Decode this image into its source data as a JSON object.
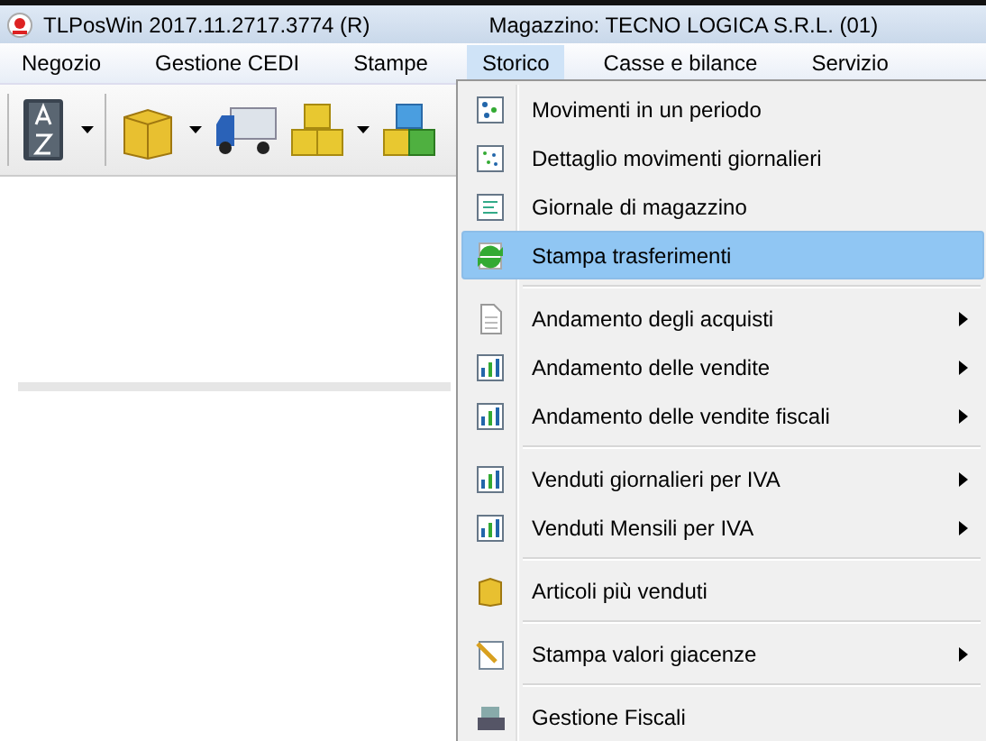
{
  "window": {
    "title": "TLPosWin 2017.11.2717.3774 (R)",
    "subtitle": "Magazzino: TECNO LOGICA S.R.L. (01)"
  },
  "menubar": [
    {
      "label": "Negozio",
      "selected": false
    },
    {
      "label": "Gestione CEDI",
      "selected": false
    },
    {
      "label": "Stampe",
      "selected": false
    },
    {
      "label": "Storico",
      "selected": true
    },
    {
      "label": "Casse e bilance",
      "selected": false
    },
    {
      "label": "Servizio",
      "selected": false
    }
  ],
  "menu": [
    {
      "kind": "item",
      "label": "Movimenti in un periodo",
      "submenu": false,
      "selected": false
    },
    {
      "kind": "item",
      "label": "Dettaglio movimenti giornalieri",
      "submenu": false,
      "selected": false
    },
    {
      "kind": "item",
      "label": "Giornale di magazzino",
      "submenu": false,
      "selected": false
    },
    {
      "kind": "item",
      "label": "Stampa trasferimenti",
      "submenu": false,
      "selected": true
    },
    {
      "kind": "separator"
    },
    {
      "kind": "item",
      "label": "Andamento degli acquisti",
      "submenu": true,
      "selected": false
    },
    {
      "kind": "item",
      "label": "Andamento delle vendite",
      "submenu": true,
      "selected": false
    },
    {
      "kind": "item",
      "label": "Andamento delle vendite fiscali",
      "submenu": true,
      "selected": false
    },
    {
      "kind": "separator"
    },
    {
      "kind": "item",
      "label": "Venduti giornalieri per IVA",
      "submenu": true,
      "selected": false
    },
    {
      "kind": "item",
      "label": "Venduti Mensili per IVA",
      "submenu": true,
      "selected": false
    },
    {
      "kind": "separator"
    },
    {
      "kind": "item",
      "label": "Articoli più venduti",
      "submenu": false,
      "selected": false
    },
    {
      "kind": "separator"
    },
    {
      "kind": "item",
      "label": "Stampa valori giacenze",
      "submenu": true,
      "selected": false
    },
    {
      "kind": "separator"
    },
    {
      "kind": "item",
      "label": "Gestione Fiscali",
      "submenu": false,
      "selected": false
    }
  ]
}
